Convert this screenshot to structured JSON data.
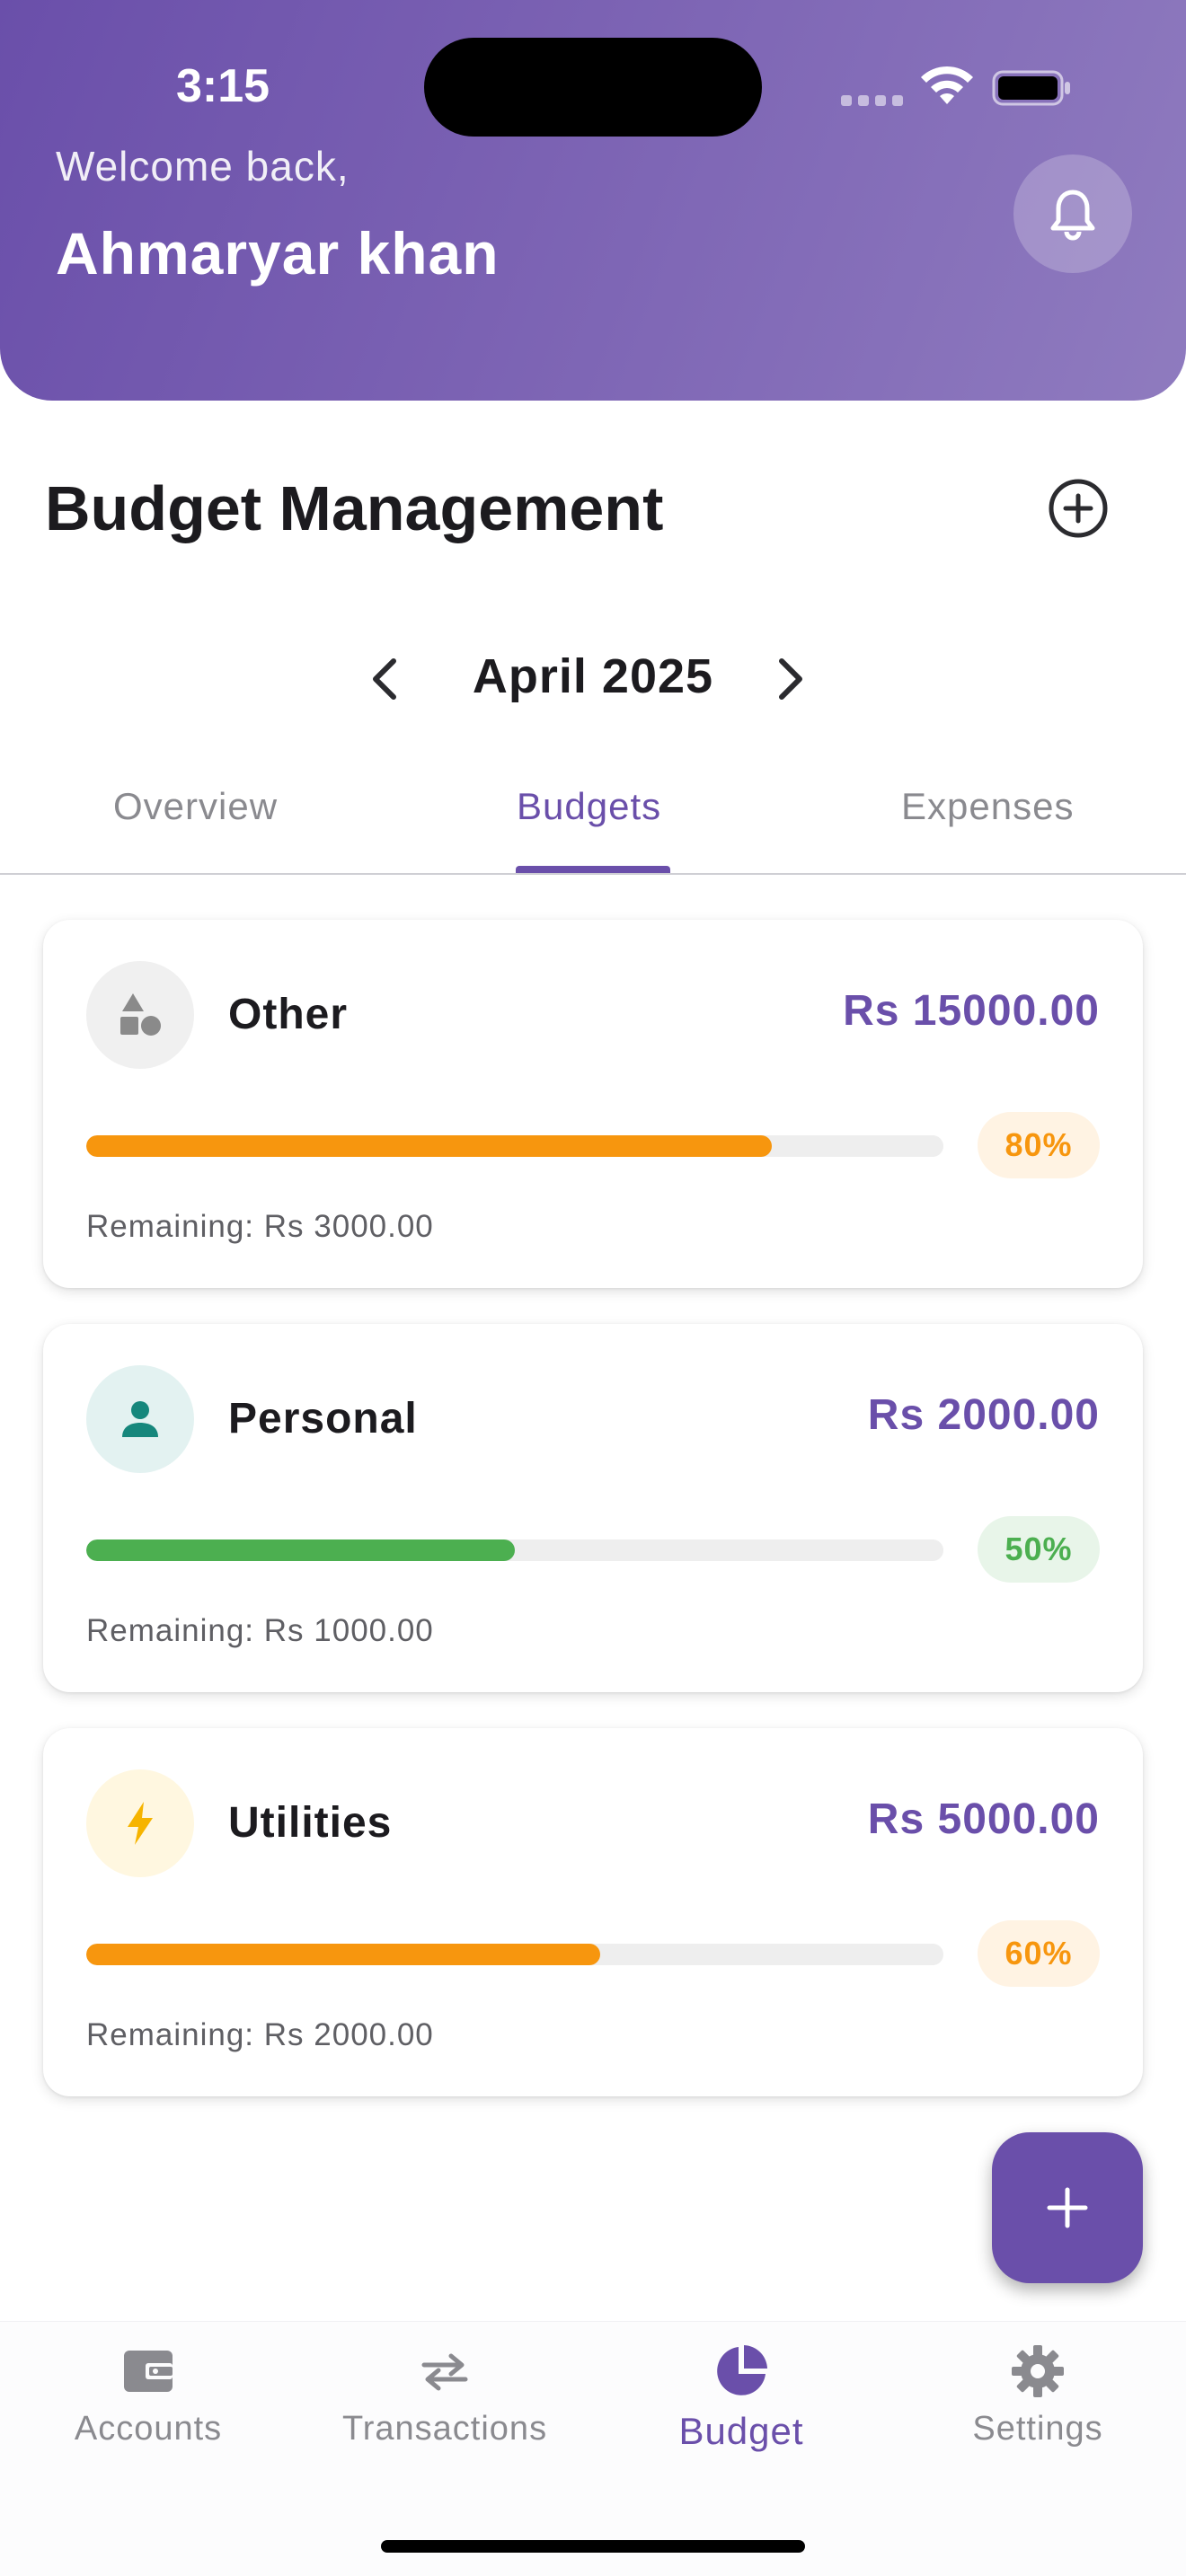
{
  "status_bar": {
    "time": "3:15"
  },
  "header": {
    "welcome": "Welcome back,",
    "username": "Ahmaryar khan",
    "bell_icon": "bell-icon"
  },
  "page": {
    "title": "Budget Management",
    "add_icon": "add-circle-icon",
    "month": "April 2025"
  },
  "tabs": [
    {
      "label": "Overview",
      "active": false
    },
    {
      "label": "Budgets",
      "active": true
    },
    {
      "label": "Expenses",
      "active": false
    }
  ],
  "budgets": [
    {
      "name": "Other",
      "amount": "Rs 15000.00",
      "percent_label": "80%",
      "progress": 0.8,
      "remaining": "Remaining: Rs 3000.00",
      "icon": "category-shapes-icon",
      "bar_color": "#f7960e",
      "badge_bg": "#fff3e3",
      "badge_color": "#f7960e",
      "icon_bg": "#f0f0f0",
      "icon_color": "#8a8a8a"
    },
    {
      "name": "Personal",
      "amount": "Rs 2000.00",
      "percent_label": "50%",
      "progress": 0.5,
      "remaining": "Remaining: Rs 1000.00",
      "icon": "person-icon",
      "bar_color": "#4caf50",
      "badge_bg": "#e8f5e9",
      "badge_color": "#4caf50",
      "icon_bg": "#e3f2f1",
      "icon_color": "#16877c"
    },
    {
      "name": "Utilities",
      "amount": "Rs 5000.00",
      "percent_label": "60%",
      "progress": 0.6,
      "remaining": "Remaining: Rs 2000.00",
      "icon": "lightning-icon",
      "bar_color": "#f7960e",
      "badge_bg": "#fff3e3",
      "badge_color": "#f7960e",
      "icon_bg": "#fff7e0",
      "icon_color": "#f6b400"
    }
  ],
  "fab": {
    "icon": "plus-icon"
  },
  "bottom_nav": [
    {
      "label": "Accounts",
      "icon": "wallet-icon",
      "active": false
    },
    {
      "label": "Transactions",
      "icon": "swap-arrows-icon",
      "active": false
    },
    {
      "label": "Budget",
      "icon": "pie-chart-icon",
      "active": true
    },
    {
      "label": "Settings",
      "icon": "gear-icon",
      "active": false
    }
  ],
  "colors": {
    "primary": "#6a4faa",
    "inactive": "#8a8a8f"
  }
}
